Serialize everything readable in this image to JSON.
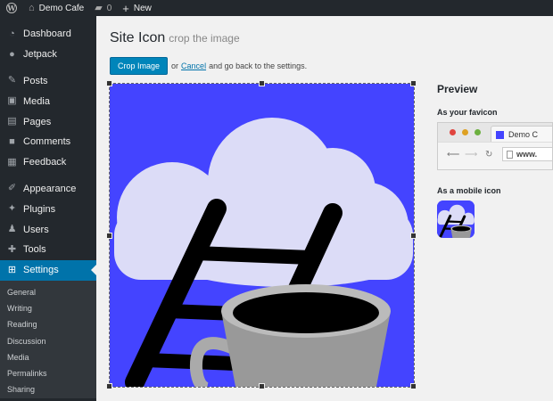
{
  "adminbar": {
    "site_name": "Demo Cafe",
    "comments_count": "0",
    "new_label": "New"
  },
  "sidebar": {
    "items": [
      {
        "label": "Dashboard",
        "icon": "dashboard-icon"
      },
      {
        "label": "Jetpack",
        "icon": "jetpack-icon"
      },
      {
        "label": "Posts",
        "icon": "pin-icon"
      },
      {
        "label": "Media",
        "icon": "media-icon"
      },
      {
        "label": "Pages",
        "icon": "pages-icon"
      },
      {
        "label": "Comments",
        "icon": "comment-icon"
      },
      {
        "label": "Feedback",
        "icon": "feedback-icon"
      },
      {
        "label": "Appearance",
        "icon": "brush-icon"
      },
      {
        "label": "Plugins",
        "icon": "plugin-icon"
      },
      {
        "label": "Users",
        "icon": "user-icon"
      },
      {
        "label": "Tools",
        "icon": "wrench-icon"
      },
      {
        "label": "Settings",
        "icon": "settings-icon"
      }
    ],
    "submenu": [
      "General",
      "Writing",
      "Reading",
      "Discussion",
      "Media",
      "Permalinks",
      "Sharing"
    ]
  },
  "main": {
    "title": "Site Icon",
    "subtitle": "crop the image",
    "crop_button": "Crop Image",
    "or_text": "or",
    "cancel_link": "Cancel",
    "after_text": "and go back to the settings."
  },
  "preview": {
    "title": "Preview",
    "favicon_label": "As your favicon",
    "tab_text": "Demo C",
    "url_text": "www.",
    "mobile_label": "As a mobile icon"
  },
  "colors": {
    "accent": "#0073aa",
    "crop_bg": "#4444ff",
    "cloud": "#dcdcf7"
  }
}
